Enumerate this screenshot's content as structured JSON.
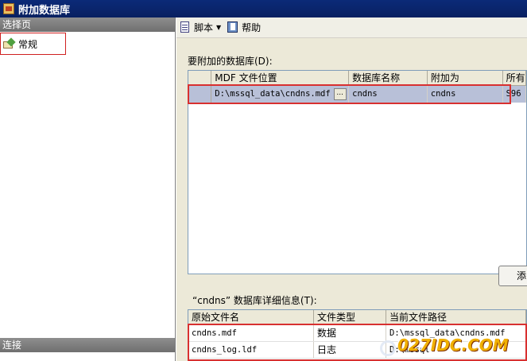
{
  "window": {
    "title": "附加数据库"
  },
  "left_panel": {
    "select_page_header": "选择页",
    "nav_items": [
      {
        "label": "常规",
        "icon": "general-page-icon"
      }
    ],
    "connect_header": "连接"
  },
  "toolbar": {
    "script_label": "脚本",
    "script_dropdown": "▼",
    "help_label": "帮助"
  },
  "attach_section": {
    "label": "要附加的数据库(D):",
    "columns": [
      "MDF 文件位置",
      "数据库名称",
      "附加为",
      "所有"
    ],
    "rows": [
      {
        "mdf": "D:\\mssql_data\\cndns.mdf",
        "browse": "...",
        "db_name": "cndns",
        "attach_as": "cndns",
        "owner": "S96"
      }
    ]
  },
  "side_button_label": "添",
  "details_section": {
    "label": "“cndns” 数据库详细信息(T):",
    "columns": [
      "原始文件名",
      "文件类型",
      "当前文件路径"
    ],
    "rows": [
      {
        "file": "cndns.mdf",
        "type": "数据",
        "path": "D:\\mssql_data\\cndns.mdf"
      },
      {
        "file": "cndns_log.ldf",
        "type": "日志",
        "path": "D:\\mssql"
      }
    ]
  },
  "watermark": {
    "text": "027IDC.COM"
  },
  "colors": {
    "title_bar": "#0a246a",
    "highlight_border": "#d83030",
    "selected_row": "#b8c0d8"
  }
}
